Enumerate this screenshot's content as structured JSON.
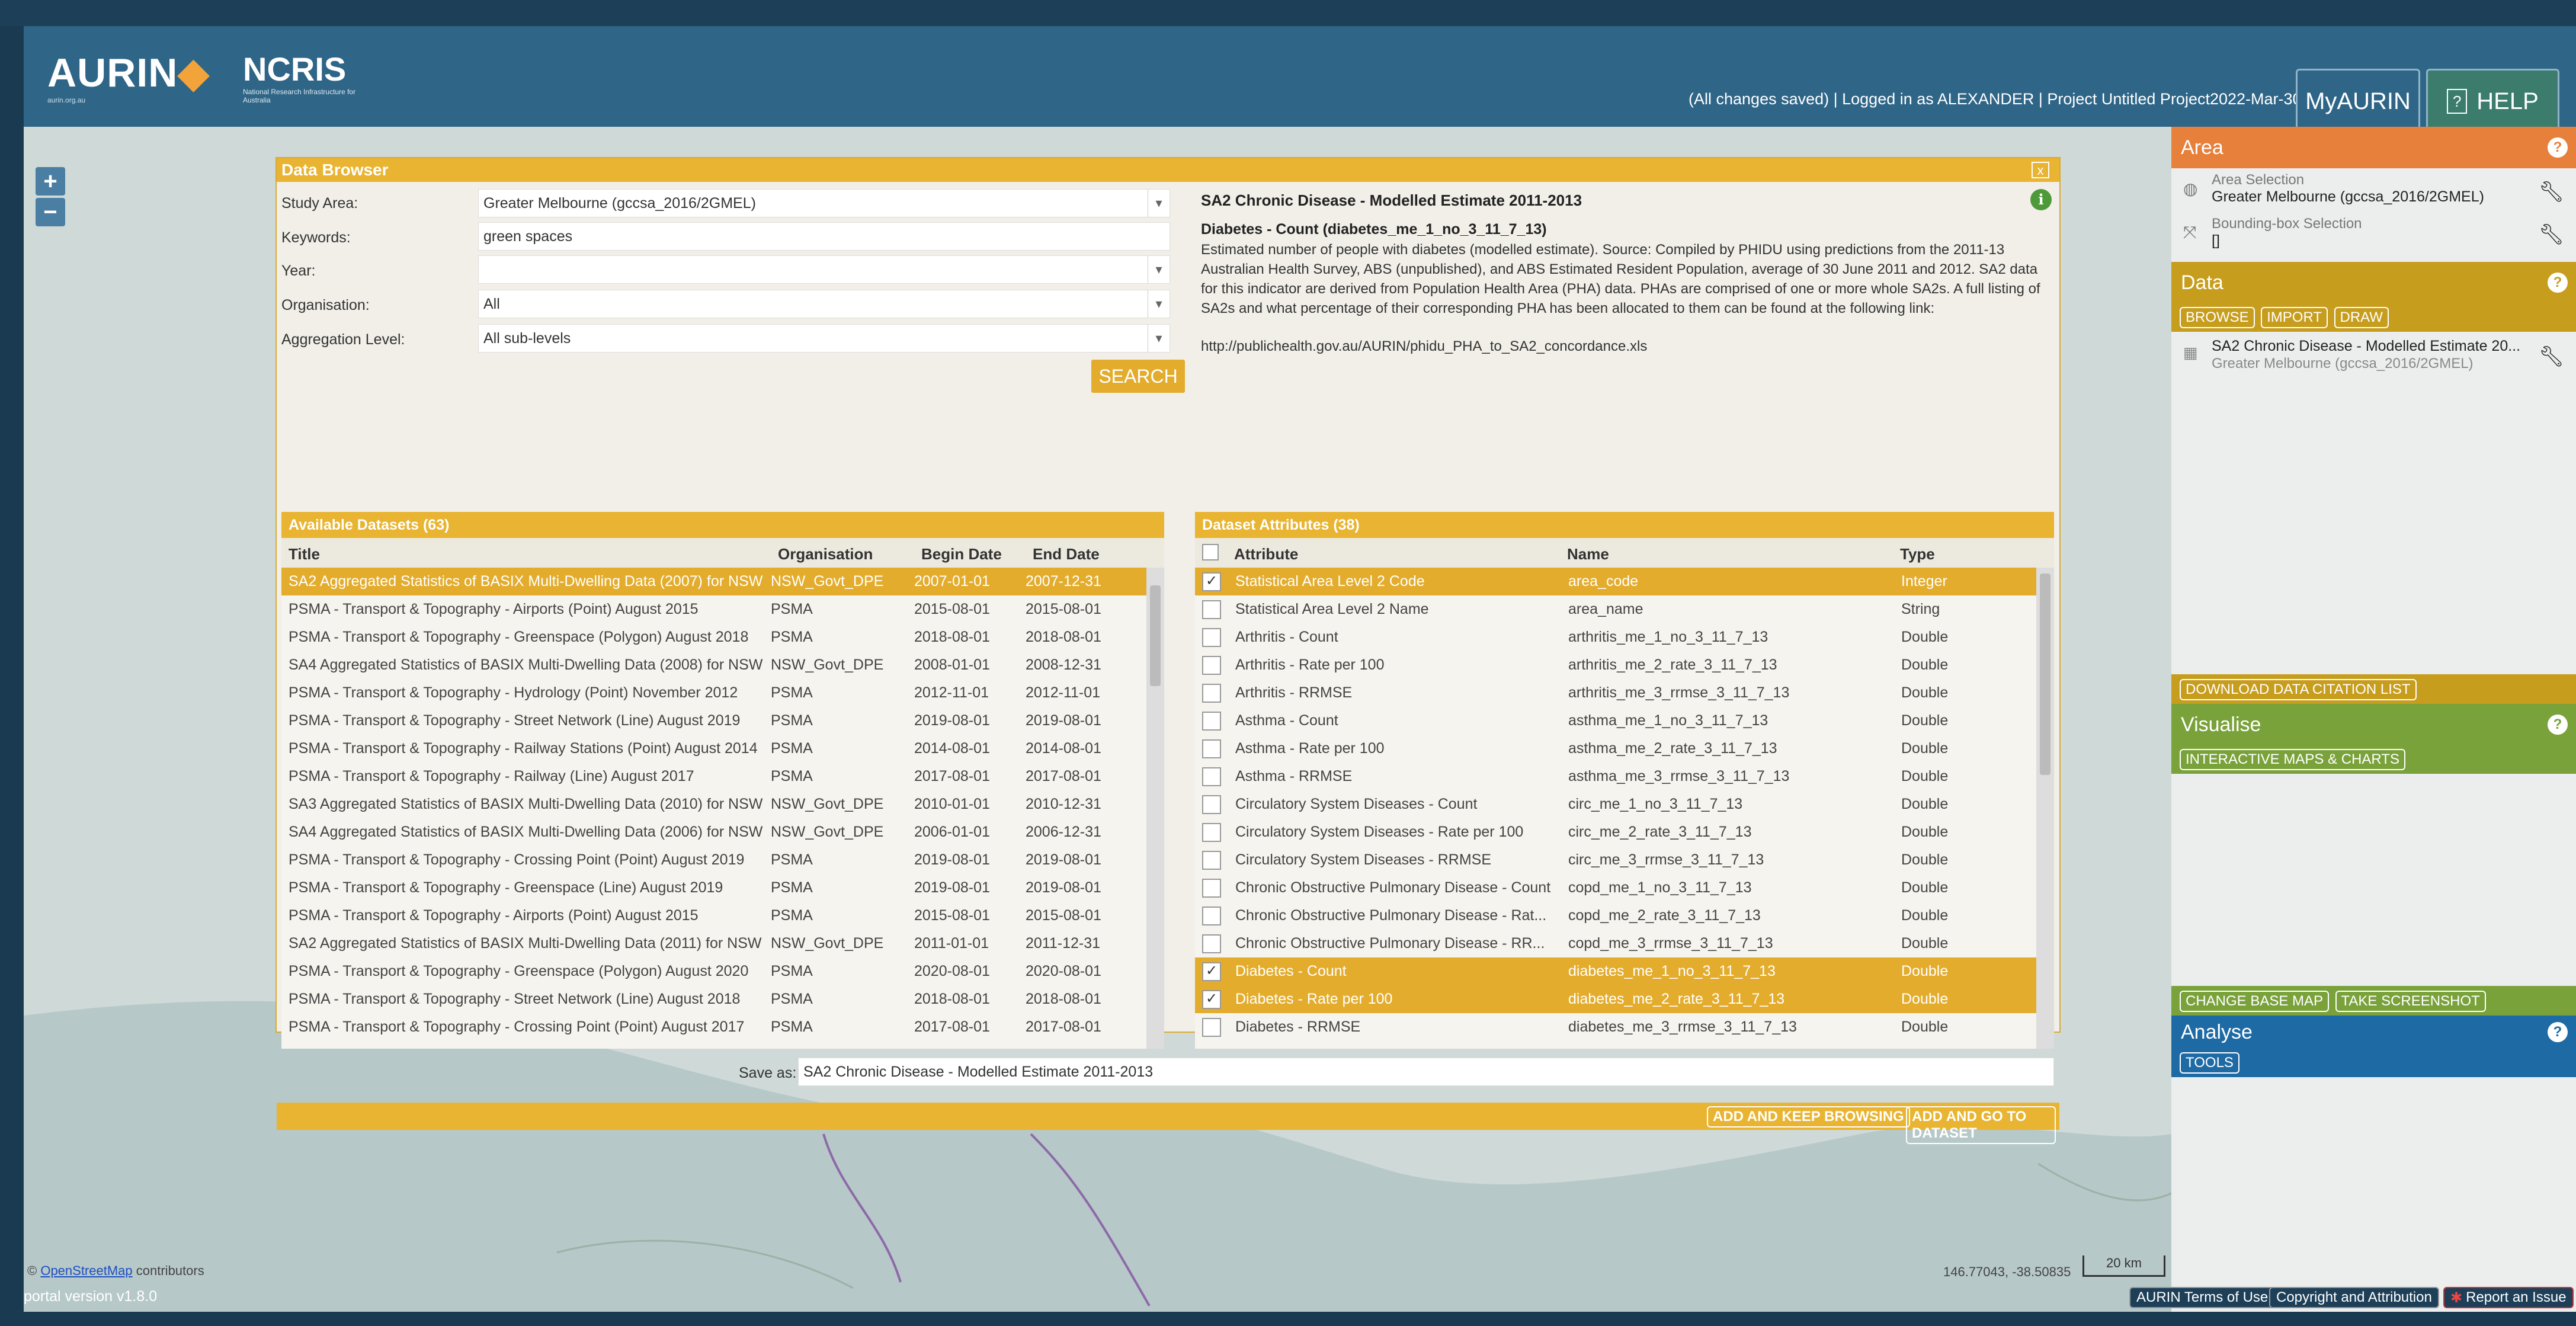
{
  "header": {
    "logo_aurin": "AURIN",
    "logo_aurin_sub": "aurin.org.au",
    "logo_ncris": "NCRIS",
    "logo_ncris_sub": "National Research Infrastructure for Australia",
    "status": "(All changes saved) | Logged in as ALEXANDER | Project Untitled Project2022-Mar-30 11:19",
    "myaurin_label": "MyAURIN",
    "help_label": "HELP"
  },
  "map": {
    "zoom_in": "+",
    "zoom_out": "−",
    "attribution_link": "OpenStreetMap",
    "attribution_suffix": "contributors",
    "coords": "146.77043, -38.50835",
    "scale": "20 km"
  },
  "browser": {
    "title": "Data Browser",
    "close": "x",
    "study_area_label": "Study Area:",
    "study_area_value": "Greater Melbourne (gccsa_2016/2GMEL)",
    "keywords_label": "Keywords:",
    "keywords_value": "green spaces",
    "year_label": "Year:",
    "year_value": "",
    "organisation_label": "Organisation:",
    "organisation_value": "All",
    "aggregation_label": "Aggregation Level:",
    "aggregation_value": "All sub-levels",
    "search_label": "SEARCH",
    "detail_title": "SA2 Chronic Disease - Modelled Estimate 2011-2013",
    "detail_subtitle": "Diabetes - Count (diabetes_me_1_no_3_11_7_13)",
    "detail_text": "Estimated number of people with diabetes (modelled estimate). Source: Compiled by PHIDU using predictions from the 2011-13 Australian Health Survey, ABS (unpublished), and ABS Estimated Resident Population, average of 30 June 2011 and 2012. SA2 data for this indicator are derived from Population Health Area (PHA) data. PHAs are comprised of one or more whole SA2s. A full listing of SA2s and what percentage of their corresponding PHA has been allocated to them can be found at the following link:",
    "detail_link": "http://publichealth.gov.au/AURIN/phidu_PHA_to_SA2_concordance.xls",
    "available_title": "Available Datasets (63)",
    "attributes_title": "Dataset Attributes (38)",
    "datasets_headers": [
      "Title",
      "Organisation",
      "Begin Date",
      "End Date"
    ],
    "attributes_headers": [
      "Attribute",
      "Name",
      "Type"
    ],
    "datasets": [
      {
        "title": "SA2 Aggregated Statistics of BASIX Multi-Dwelling Data (2007) for NSW",
        "org": "NSW_Govt_DPE",
        "begin": "2007-01-01",
        "end": "2007-12-31",
        "selected": true
      },
      {
        "title": "PSMA - Transport & Topography - Airports (Point) August 2015",
        "org": "PSMA",
        "begin": "2015-08-01",
        "end": "2015-08-01"
      },
      {
        "title": "PSMA - Transport & Topography - Greenspace (Polygon) August 2018",
        "org": "PSMA",
        "begin": "2018-08-01",
        "end": "2018-08-01"
      },
      {
        "title": "SA4 Aggregated Statistics of BASIX Multi-Dwelling Data (2008) for NSW",
        "org": "NSW_Govt_DPE",
        "begin": "2008-01-01",
        "end": "2008-12-31"
      },
      {
        "title": "PSMA - Transport & Topography - Hydrology (Point) November 2012",
        "org": "PSMA",
        "begin": "2012-11-01",
        "end": "2012-11-01"
      },
      {
        "title": "PSMA - Transport & Topography - Street Network (Line) August 2019",
        "org": "PSMA",
        "begin": "2019-08-01",
        "end": "2019-08-01"
      },
      {
        "title": "PSMA - Transport & Topography - Railway Stations (Point) August 2014",
        "org": "PSMA",
        "begin": "2014-08-01",
        "end": "2014-08-01"
      },
      {
        "title": "PSMA - Transport & Topography - Railway (Line) August 2017",
        "org": "PSMA",
        "begin": "2017-08-01",
        "end": "2017-08-01"
      },
      {
        "title": "SA3 Aggregated Statistics of BASIX Multi-Dwelling Data (2010) for NSW",
        "org": "NSW_Govt_DPE",
        "begin": "2010-01-01",
        "end": "2010-12-31"
      },
      {
        "title": "SA4 Aggregated Statistics of BASIX Multi-Dwelling Data (2006) for NSW",
        "org": "NSW_Govt_DPE",
        "begin": "2006-01-01",
        "end": "2006-12-31"
      },
      {
        "title": "PSMA - Transport & Topography - Crossing Point (Point) August 2019",
        "org": "PSMA",
        "begin": "2019-08-01",
        "end": "2019-08-01"
      },
      {
        "title": "PSMA - Transport & Topography - Greenspace (Line) August 2019",
        "org": "PSMA",
        "begin": "2019-08-01",
        "end": "2019-08-01"
      },
      {
        "title": "PSMA - Transport & Topography - Airports (Point) August 2015",
        "org": "PSMA",
        "begin": "2015-08-01",
        "end": "2015-08-01"
      },
      {
        "title": "SA2 Aggregated Statistics of BASIX Multi-Dwelling Data (2011) for NSW",
        "org": "NSW_Govt_DPE",
        "begin": "2011-01-01",
        "end": "2011-12-31"
      },
      {
        "title": "PSMA - Transport & Topography - Greenspace (Polygon) August 2020",
        "org": "PSMA",
        "begin": "2020-08-01",
        "end": "2020-08-01"
      },
      {
        "title": "PSMA - Transport & Topography - Street Network (Line) August 2018",
        "org": "PSMA",
        "begin": "2018-08-01",
        "end": "2018-08-01"
      },
      {
        "title": "PSMA - Transport & Topography - Crossing Point (Point) August 2017",
        "org": "PSMA",
        "begin": "2017-08-01",
        "end": "2017-08-01"
      }
    ],
    "attributes": [
      {
        "attr": "Statistical Area Level 2 Code",
        "name": "area_code",
        "type": "Integer",
        "checked": true,
        "selected": true
      },
      {
        "attr": "Statistical Area Level 2 Name",
        "name": "area_name",
        "type": "String"
      },
      {
        "attr": "Arthritis - Count",
        "name": "arthritis_me_1_no_3_11_7_13",
        "type": "Double"
      },
      {
        "attr": "Arthritis - Rate per 100",
        "name": "arthritis_me_2_rate_3_11_7_13",
        "type": "Double"
      },
      {
        "attr": "Arthritis - RRMSE",
        "name": "arthritis_me_3_rrmse_3_11_7_13",
        "type": "Double"
      },
      {
        "attr": "Asthma - Count",
        "name": "asthma_me_1_no_3_11_7_13",
        "type": "Double"
      },
      {
        "attr": "Asthma - Rate per 100",
        "name": "asthma_me_2_rate_3_11_7_13",
        "type": "Double"
      },
      {
        "attr": "Asthma - RRMSE",
        "name": "asthma_me_3_rrmse_3_11_7_13",
        "type": "Double"
      },
      {
        "attr": "Circulatory System Diseases - Count",
        "name": "circ_me_1_no_3_11_7_13",
        "type": "Double"
      },
      {
        "attr": "Circulatory System Diseases - Rate per 100",
        "name": "circ_me_2_rate_3_11_7_13",
        "type": "Double"
      },
      {
        "attr": "Circulatory System Diseases - RRMSE",
        "name": "circ_me_3_rrmse_3_11_7_13",
        "type": "Double"
      },
      {
        "attr": "Chronic Obstructive Pulmonary Disease - Count",
        "name": "copd_me_1_no_3_11_7_13",
        "type": "Double"
      },
      {
        "attr": "Chronic Obstructive Pulmonary Disease - Rat...",
        "name": "copd_me_2_rate_3_11_7_13",
        "type": "Double"
      },
      {
        "attr": "Chronic Obstructive Pulmonary Disease - RR...",
        "name": "copd_me_3_rrmse_3_11_7_13",
        "type": "Double"
      },
      {
        "attr": "Diabetes - Count",
        "name": "diabetes_me_1_no_3_11_7_13",
        "type": "Double",
        "checked": true,
        "selected": true
      },
      {
        "attr": "Diabetes - Rate per 100",
        "name": "diabetes_me_2_rate_3_11_7_13",
        "type": "Double",
        "checked": true,
        "selected": true
      },
      {
        "attr": "Diabetes - RRMSE",
        "name": "diabetes_me_3_rrmse_3_11_7_13",
        "type": "Double"
      }
    ],
    "save_as_label": "Save as:",
    "save_as_value": "SA2 Chronic Disease - Modelled Estimate 2011-2013",
    "add_keep_label": "ADD AND KEEP BROWSING",
    "add_go_label": "ADD AND GO TO DATASET"
  },
  "sidebar": {
    "area_title": "Area",
    "area_selection_label": "Area Selection",
    "area_selection_value": "Greater Melbourne (gccsa_2016/2GMEL)",
    "bbox_label": "Bounding-box Selection",
    "bbox_value": "[]",
    "data_title": "Data",
    "data_buttons": [
      "BROWSE",
      "IMPORT",
      "DRAW"
    ],
    "data_item_title": "SA2 Chronic Disease - Modelled Estimate 20...",
    "data_item_sub": "Greater Melbourne (gccsa_2016/2GMEL)",
    "download_label": "DOWNLOAD DATA CITATION LIST",
    "visualise_title": "Visualise",
    "interactive_label": "INTERACTIVE MAPS & CHARTS",
    "change_base_label": "CHANGE BASE MAP",
    "screenshot_label": "TAKE SCREENSHOT",
    "analyse_title": "Analyse",
    "tools_label": "TOOLS",
    "help_glyph": "?"
  },
  "footer": {
    "version": "portal version v1.8.0",
    "terms": "AURIN Terms of Use",
    "copyright": "Copyright and Attribution",
    "report": "Report an Issue"
  },
  "colors": {
    "header": "#2f6587",
    "accent_yellow": "#e3ac2c",
    "area_orange": "#e7803a",
    "data_olive": "#c79d1d",
    "visualise_green": "#7aa23a",
    "analyse_blue": "#1e6aa5"
  }
}
